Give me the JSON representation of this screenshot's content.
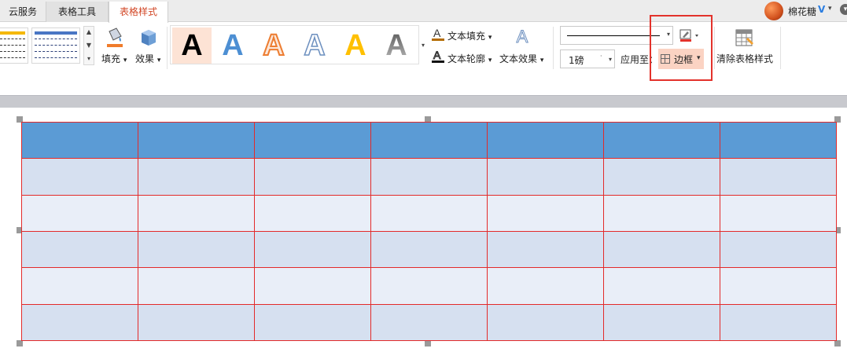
{
  "tabs": [
    {
      "label": "云服务",
      "active": false
    },
    {
      "label": "表格工具",
      "active": false
    },
    {
      "label": "表格样式",
      "active": true
    }
  ],
  "user": {
    "name": "棉花糖",
    "vip_badge": "V",
    "caret": "▾",
    "more_glyph": "▾"
  },
  "ribbon": {
    "fill_label": "填充",
    "effects_label": "效果",
    "wordart_letter": "A",
    "text_fill_label": "文本填充",
    "text_outline_label": "文本轮廓",
    "text_effects_label": "文本效果",
    "line_weight_value": "1磅",
    "apply_to_label": "应用至：",
    "border_label": "边框",
    "clear_style_label": "清除表格样式",
    "caret": "▾"
  },
  "colors": {
    "active_tab_text": "#d24726",
    "highlight_box": "#e3322b",
    "table_border": "#e32a2a",
    "header_fill": "#5b9bd5",
    "band_fill": "#d6e0f0",
    "alt_band_fill": "#e9eef8"
  },
  "table": {
    "columns": 7,
    "rows": 6,
    "header_rows": 1
  }
}
